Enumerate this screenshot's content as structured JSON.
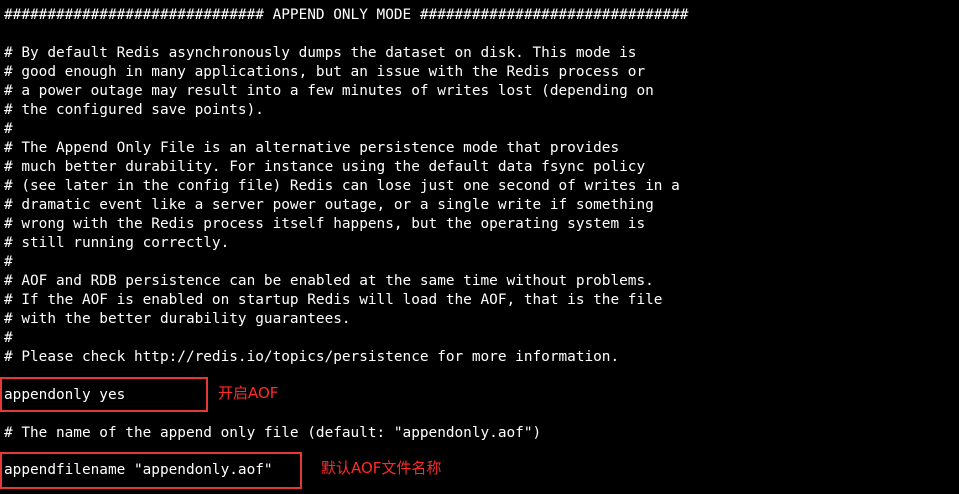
{
  "terminal": {
    "lines": [
      "############################## APPEND ONLY MODE ###############################",
      "",
      "# By default Redis asynchronously dumps the dataset on disk. This mode is",
      "# good enough in many applications, but an issue with the Redis process or",
      "# a power outage may result into a few minutes of writes lost (depending on",
      "# the configured save points).",
      "#",
      "# The Append Only File is an alternative persistence mode that provides",
      "# much better durability. For instance using the default data fsync policy",
      "# (see later in the config file) Redis can lose just one second of writes in a",
      "# dramatic event like a server power outage, or a single write if something",
      "# wrong with the Redis process itself happens, but the operating system is",
      "# still running correctly.",
      "#",
      "# AOF and RDB persistence can be enabled at the same time without problems.",
      "# If the AOF is enabled on startup Redis will load the AOF, that is the file",
      "# with the better durability guarantees.",
      "#",
      "# Please check http://redis.io/topics/persistence for more information.",
      "",
      "appendonly yes",
      "",
      "# The name of the append only file (default: \"appendonly.aof\")",
      "",
      "appendfilename \"appendonly.aof\""
    ]
  },
  "annotations": {
    "appendonly": "开启AOF",
    "appendfilename": "默认AOF文件名称"
  },
  "colors": {
    "background": "#000000",
    "text": "#ffffff",
    "highlight": "#e53935",
    "annotation": "#ff2b2b"
  }
}
